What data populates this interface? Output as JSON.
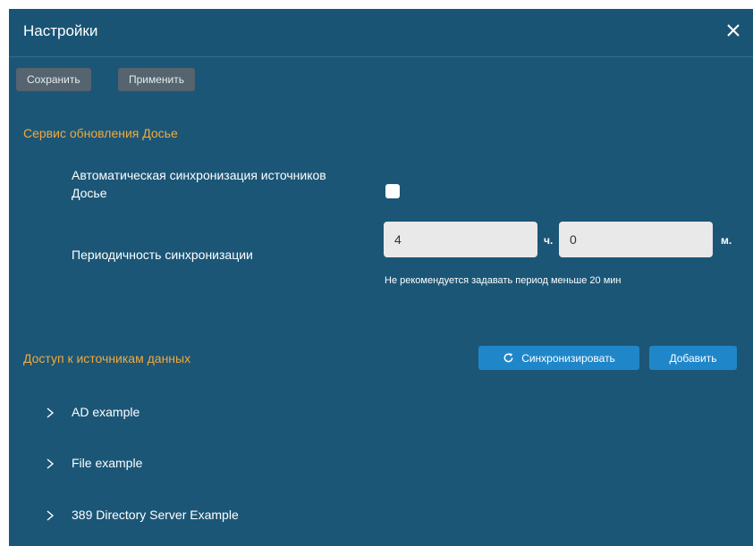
{
  "dialog": {
    "title": "Настройки"
  },
  "toolbar": {
    "save_label": "Сохранить",
    "apply_label": "Применить"
  },
  "dossier_service": {
    "section_title": "Сервис обновления Досье",
    "auto_sync_label_line1": "Автоматическая синхронизация источников",
    "auto_sync_label_line2": "Досье",
    "auto_sync_checked": false,
    "period_label": "Периодичность синхронизации",
    "hours_value": "4",
    "hours_unit": "ч.",
    "minutes_value": "0",
    "minutes_unit": "м.",
    "hint": "Не рекомендуется задавать период меньше 20 мин"
  },
  "data_access": {
    "section_title": "Доступ к источникам данных",
    "sync_label": "Синхронизировать",
    "add_label": "Добавить",
    "sources": [
      {
        "name": "AD example"
      },
      {
        "name": "File example"
      },
      {
        "name": "389 Directory Server Example"
      }
    ]
  },
  "colors": {
    "background": "#1b5677",
    "accent_orange": "#f2a93b",
    "button_blue": "#1f87c9",
    "button_gray": "#55646e"
  }
}
